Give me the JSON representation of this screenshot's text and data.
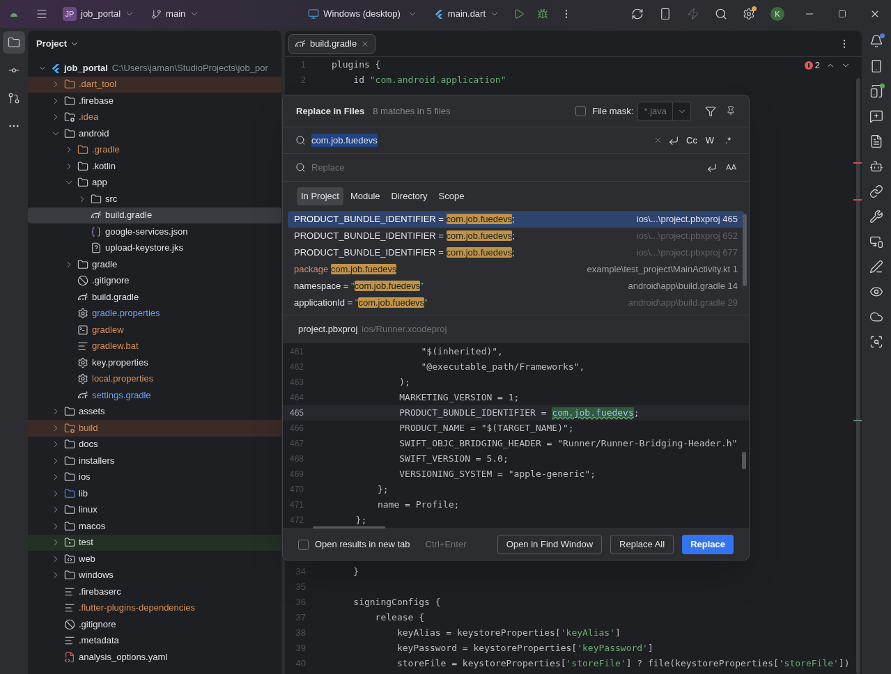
{
  "title_bar": {
    "project_badge": "JP",
    "project": "job_portal",
    "branch": "main",
    "device": "Windows (desktop)",
    "run_config": "main.dart",
    "settings_badge": true,
    "hot_reload_disabled": true,
    "avatar": "K"
  },
  "left_toolbar": [
    {
      "kind": "project",
      "selected": true
    },
    {
      "kind": "commit",
      "selected": false
    },
    {
      "kind": "pull-requests",
      "selected": false
    },
    {
      "kind": "more",
      "selected": false
    }
  ],
  "project_panel": {
    "title": "Project",
    "tree": [
      {
        "name": "job_portal",
        "path": "C:\\Users\\jaman\\StudioProjects\\job_por",
        "kind": "flutter-project",
        "expanded": true,
        "selected": false,
        "color": "#dfe1e5",
        "children": [
          {
            "name": ".dart_tool",
            "kind": "excluded-folder",
            "expanded": false,
            "selected": false,
            "color": "#d5905d"
          },
          {
            "name": ".firebase",
            "kind": "folder",
            "expanded": false,
            "selected": false,
            "color": "#dfe1e5"
          },
          {
            "name": ".idea",
            "kind": "config-folder",
            "expanded": false,
            "selected": false,
            "color": "#d5905d"
          },
          {
            "name": "android",
            "kind": "folder",
            "expanded": true,
            "selected": false,
            "color": "#dfe1e5",
            "children": [
              {
                "name": ".gradle",
                "kind": "ignored-folder",
                "expanded": false,
                "selected": false,
                "color": "#d5905d"
              },
              {
                "name": ".kotlin",
                "kind": "folder",
                "expanded": false,
                "selected": false,
                "color": "#dfe1e5"
              },
              {
                "name": "app",
                "kind": "folder",
                "expanded": true,
                "selected": false,
                "color": "#dfe1e5",
                "children": [
                  {
                    "name": "src",
                    "kind": "folder",
                    "expanded": false,
                    "selected": false,
                    "color": "#dfe1e5"
                  },
                  {
                    "name": "build.gradle",
                    "kind": "gradle",
                    "selected": true,
                    "color": "#dfe1e5"
                  },
                  {
                    "name": "google-services.json",
                    "kind": "json",
                    "selected": false,
                    "color": "#dfe1e5"
                  },
                  {
                    "name": "upload-keystore.jks",
                    "kind": "unknown",
                    "selected": false,
                    "color": "#dfe1e5"
                  }
                ]
              },
              {
                "name": "gradle",
                "kind": "folder",
                "expanded": false,
                "selected": false,
                "color": "#dfe1e5"
              },
              {
                "name": ".gitignore",
                "kind": "ignore",
                "selected": false,
                "color": "#dfe1e5"
              },
              {
                "name": "build.gradle",
                "kind": "gradle",
                "selected": false,
                "color": "#dfe1e5"
              },
              {
                "name": "gradle.properties",
                "kind": "settings",
                "selected": false,
                "color": "#6f9ff8"
              },
              {
                "name": "gradlew",
                "kind": "terminal",
                "selected": false,
                "color": "#d5905d"
              },
              {
                "name": "gradlew.bat",
                "kind": "text",
                "selected": false,
                "color": "#d5905d"
              },
              {
                "name": "key.properties",
                "kind": "settings",
                "selected": false,
                "color": "#dfe1e5"
              },
              {
                "name": "local.properties",
                "kind": "settings",
                "selected": false,
                "color": "#d5905d"
              },
              {
                "name": "settings.gradle",
                "kind": "gradle",
                "selected": false,
                "color": "#6f9ff8"
              }
            ]
          },
          {
            "name": "assets",
            "kind": "folder",
            "expanded": false,
            "selected": false,
            "color": "#dfe1e5"
          },
          {
            "name": "build",
            "kind": "excluded-config-folder",
            "expanded": false,
            "selected": false,
            "color": "#d5905d"
          },
          {
            "name": "docs",
            "kind": "folder",
            "expanded": false,
            "selected": false,
            "color": "#dfe1e5"
          },
          {
            "name": "installers",
            "kind": "folder",
            "expanded": false,
            "selected": false,
            "color": "#dfe1e5"
          },
          {
            "name": "ios",
            "kind": "folder",
            "expanded": false,
            "selected": false,
            "color": "#dfe1e5"
          },
          {
            "name": "lib",
            "kind": "source-folder",
            "expanded": false,
            "selected": false,
            "color": "#dfe1e5"
          },
          {
            "name": "linux",
            "kind": "folder",
            "expanded": false,
            "selected": false,
            "color": "#dfe1e5"
          },
          {
            "name": "macos",
            "kind": "folder",
            "expanded": false,
            "selected": false,
            "color": "#dfe1e5"
          },
          {
            "name": "test",
            "kind": "test-folder",
            "expanded": false,
            "selected": false,
            "color": "#dfe1e5"
          },
          {
            "name": "web",
            "kind": "web-folder",
            "expanded": false,
            "selected": false,
            "color": "#dfe1e5"
          },
          {
            "name": "windows",
            "kind": "folder",
            "expanded": false,
            "selected": false,
            "color": "#dfe1e5"
          },
          {
            "name": ".firebaserc",
            "kind": "text",
            "selected": false,
            "color": "#dfe1e5"
          },
          {
            "name": ".flutter-plugins-dependencies",
            "kind": "text",
            "selected": false,
            "color": "#d5905d"
          },
          {
            "name": ".gitignore",
            "kind": "ignore",
            "selected": false,
            "color": "#dfe1e5"
          },
          {
            "name": ".metadata",
            "kind": "text",
            "selected": false,
            "color": "#dfe1e5"
          },
          {
            "name": "analysis_options.yaml",
            "kind": "yaml",
            "selected": false,
            "color": "#dfe1e5"
          }
        ]
      }
    ]
  },
  "editor": {
    "tabs": [
      {
        "label": "build.gradle",
        "selected": true
      }
    ],
    "error_count": "2",
    "lines_top": [
      {
        "number": "1",
        "parts": [
          {
            "text": "plugins {",
            "kind": "plain"
          }
        ]
      },
      {
        "number": "2",
        "parts": [
          {
            "text": "    id ",
            "kind": "plain"
          },
          {
            "text": "\"com.android.application\"",
            "kind": "string"
          }
        ]
      }
    ],
    "lines_bottom": [
      {
        "number": "34",
        "parts": [
          {
            "text": "    }",
            "kind": "plain"
          }
        ]
      },
      {
        "number": "35"
      },
      {
        "number": "36",
        "parts": [
          {
            "text": "    signingConfigs {",
            "kind": "plain"
          }
        ]
      },
      {
        "number": "37",
        "parts": [
          {
            "text": "        release {",
            "kind": "plain"
          }
        ]
      },
      {
        "number": "38",
        "parts": [
          {
            "text": "            keyAlias = keystoreProperties[",
            "kind": "plain"
          },
          {
            "text": "'keyAlias'",
            "kind": "string"
          },
          {
            "text": "]",
            "kind": "plain"
          }
        ]
      },
      {
        "number": "39",
        "parts": [
          {
            "text": "            keyPassword = keystoreProperties[",
            "kind": "plain"
          },
          {
            "text": "'keyPassword'",
            "kind": "string"
          },
          {
            "text": "]",
            "kind": "plain"
          }
        ]
      },
      {
        "number": "40",
        "parts": [
          {
            "text": "            storeFile = keystoreProperties[",
            "kind": "plain"
          },
          {
            "text": "'storeFile'",
            "kind": "string"
          },
          {
            "text": "] ? file(keystoreProperties[",
            "kind": "plain"
          },
          {
            "text": "'storeFile'",
            "kind": "string"
          },
          {
            "text": "])",
            "kind": "plain"
          }
        ]
      }
    ]
  },
  "replace_dialog": {
    "title": "Replace in Files",
    "summary": "8 matches in 5 files",
    "file_mask": {
      "label": "File mask:",
      "checked": false,
      "value": "*.java"
    },
    "search": {
      "value": "com.job.fuedevs",
      "text_selected": true,
      "toggles": [
        {
          "label": "Cc",
          "selected": false
        },
        {
          "label": "W",
          "selected": false
        },
        {
          "label": ".*",
          "selected": false
        }
      ]
    },
    "replace": {
      "placeholder": "Replace",
      "preserve_case": "AA"
    },
    "scopes": [
      {
        "label": "In Project",
        "selected": true
      },
      {
        "label": "Module",
        "selected": false
      },
      {
        "label": "Directory",
        "selected": false
      },
      {
        "label": "Scope",
        "selected": false
      }
    ],
    "results": [
      {
        "parts": [
          {
            "text": "PRODUCT_BUNDLE_IDENTIFIER = ",
            "kind": "plain"
          },
          {
            "text": "com.job.fuedevs",
            "kind": "match"
          },
          {
            "text": ";",
            "kind": "plain"
          }
        ],
        "file": "ios\\...\\project.pbxproj 465",
        "selected": true,
        "dimmed": false
      },
      {
        "parts": [
          {
            "text": "PRODUCT_BUNDLE_IDENTIFIER = ",
            "kind": "plain"
          },
          {
            "text": "com.job.fuedevs",
            "kind": "match"
          },
          {
            "text": ";",
            "kind": "plain"
          }
        ],
        "file": "ios\\...\\project.pbxproj 652",
        "selected": false,
        "dimmed": true
      },
      {
        "parts": [
          {
            "text": "PRODUCT_BUNDLE_IDENTIFIER = ",
            "kind": "plain"
          },
          {
            "text": "com.job.fuedevs",
            "kind": "match"
          },
          {
            "text": ";",
            "kind": "plain"
          }
        ],
        "file": "ios\\...\\project.pbxproj 677",
        "selected": false,
        "dimmed": true
      },
      {
        "parts": [
          {
            "text": "package ",
            "kind": "keyword"
          },
          {
            "text": "com.job.fuedevs",
            "kind": "match"
          }
        ],
        "file": "example\\test_project\\MainActivity.kt 1",
        "selected": false,
        "dimmed": false
      },
      {
        "parts": [
          {
            "text": "namespace = ",
            "kind": "plain"
          },
          {
            "text": "\"",
            "kind": "string"
          },
          {
            "text": "com.job.fuedevs",
            "kind": "match"
          },
          {
            "text": "\"",
            "kind": "string"
          }
        ],
        "file": "android\\app\\build.gradle 14",
        "selected": false,
        "dimmed": false
      },
      {
        "parts": [
          {
            "text": "applicationId = ",
            "kind": "plain"
          },
          {
            "text": "\"",
            "kind": "string"
          },
          {
            "text": "com.job.fuedevs",
            "kind": "match"
          },
          {
            "text": "\"",
            "kind": "string"
          }
        ],
        "file": "android\\app\\build.gradle 29",
        "selected": false,
        "dimmed": true
      }
    ],
    "preview": {
      "file": "project.pbxproj",
      "folder": "ios/Runner.xcodeproj",
      "lines": [
        {
          "number": "461",
          "current": false,
          "parts": [
            {
              "text": "                    \"$(inherited)\",",
              "kind": "plain"
            }
          ]
        },
        {
          "number": "462",
          "current": false,
          "parts": [
            {
              "text": "                    \"@executable_path/Frameworks\",",
              "kind": "plain"
            }
          ]
        },
        {
          "number": "463",
          "current": false,
          "parts": [
            {
              "text": "                );",
              "kind": "plain"
            }
          ]
        },
        {
          "number": "464",
          "current": false,
          "parts": [
            {
              "text": "                MARKETING_VERSION = 1;",
              "kind": "plain"
            }
          ]
        },
        {
          "number": "465",
          "current": true,
          "parts": [
            {
              "text": "                PRODUCT_BUNDLE_IDENTIFIER = ",
              "kind": "plain"
            },
            {
              "text": "com.job.fuedevs",
              "kind": "found"
            },
            {
              "text": ";",
              "kind": "plain"
            }
          ]
        },
        {
          "number": "466",
          "current": false,
          "parts": [
            {
              "text": "                PRODUCT_NAME = \"$(TARGET_NAME)\";",
              "kind": "plain"
            }
          ]
        },
        {
          "number": "467",
          "current": false,
          "parts": [
            {
              "text": "                SWIFT_OBJC_BRIDGING_HEADER = \"Runner/Runner-Bridging-Header.h\"",
              "kind": "plain"
            }
          ]
        },
        {
          "number": "468",
          "current": false,
          "parts": [
            {
              "text": "                SWIFT_VERSION = 5.0;",
              "kind": "plain"
            }
          ]
        },
        {
          "number": "469",
          "current": false,
          "parts": [
            {
              "text": "                VERSIONING_SYSTEM = \"apple-generic\";",
              "kind": "plain"
            }
          ]
        },
        {
          "number": "470",
          "current": false,
          "parts": [
            {
              "text": "            };",
              "kind": "plain"
            }
          ]
        },
        {
          "number": "471",
          "current": false,
          "parts": [
            {
              "text": "            name = Profile;",
              "kind": "plain"
            }
          ]
        },
        {
          "number": "472",
          "current": false,
          "parts": [
            {
              "text": "        };",
              "kind": "plain"
            }
          ]
        }
      ]
    },
    "new_tab": {
      "label": "Open results in new tab",
      "checked": false,
      "shortcut": "Ctrl+Enter"
    },
    "buttons": [
      {
        "label": "Open in Find Window",
        "kind": "secondary"
      },
      {
        "label": "Replace All",
        "kind": "secondary"
      },
      {
        "label": "Replace",
        "kind": "primary"
      }
    ]
  },
  "right_toolbar": [
    {
      "kind": "notifications",
      "badge": true
    },
    {
      "kind": "device-manager",
      "badge": false
    },
    {
      "kind": "running-devices",
      "badge": true
    },
    {
      "kind": "chat",
      "badge": false
    },
    {
      "kind": "logcat",
      "badge": false
    },
    {
      "kind": "assistant",
      "badge": false
    },
    {
      "kind": "link",
      "badge": false
    },
    {
      "kind": "tools",
      "badge": false
    },
    {
      "kind": "inspection",
      "badge": false
    },
    {
      "kind": "edit",
      "badge": false
    },
    {
      "kind": "preview",
      "badge": false
    },
    {
      "kind": "cloud",
      "badge": false
    },
    {
      "kind": "scan",
      "badge": false
    }
  ]
}
